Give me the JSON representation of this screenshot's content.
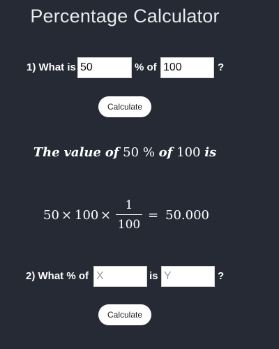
{
  "page": {
    "title": "Percentage Calculator"
  },
  "question1": {
    "prefix": "1) What is",
    "value_a": "50",
    "middle": "% of",
    "value_b": "100",
    "suffix": "?",
    "button_label": "Calculate"
  },
  "result": {
    "word_the": "The",
    "word_value": "value",
    "word_of": "of",
    "percent_value": "50",
    "percent_sign": "%",
    "word_of_2": "of",
    "base_value": "100",
    "word_is": "is"
  },
  "formula": {
    "term_a": "50",
    "times_1": "×",
    "term_b": "100",
    "times_2": "×",
    "fraction_numerator": "1",
    "fraction_denominator": "100",
    "equals": "=",
    "answer": "50.000"
  },
  "question2": {
    "prefix": "2) What % of",
    "placeholder_x": "X",
    "middle": "is",
    "placeholder_y": "Y",
    "suffix": "?",
    "button_label": "Calculate"
  },
  "colors": {
    "background": "#252a35",
    "text": "#ffffff",
    "input_background": "#ffffff",
    "button_background": "#ffffff"
  }
}
